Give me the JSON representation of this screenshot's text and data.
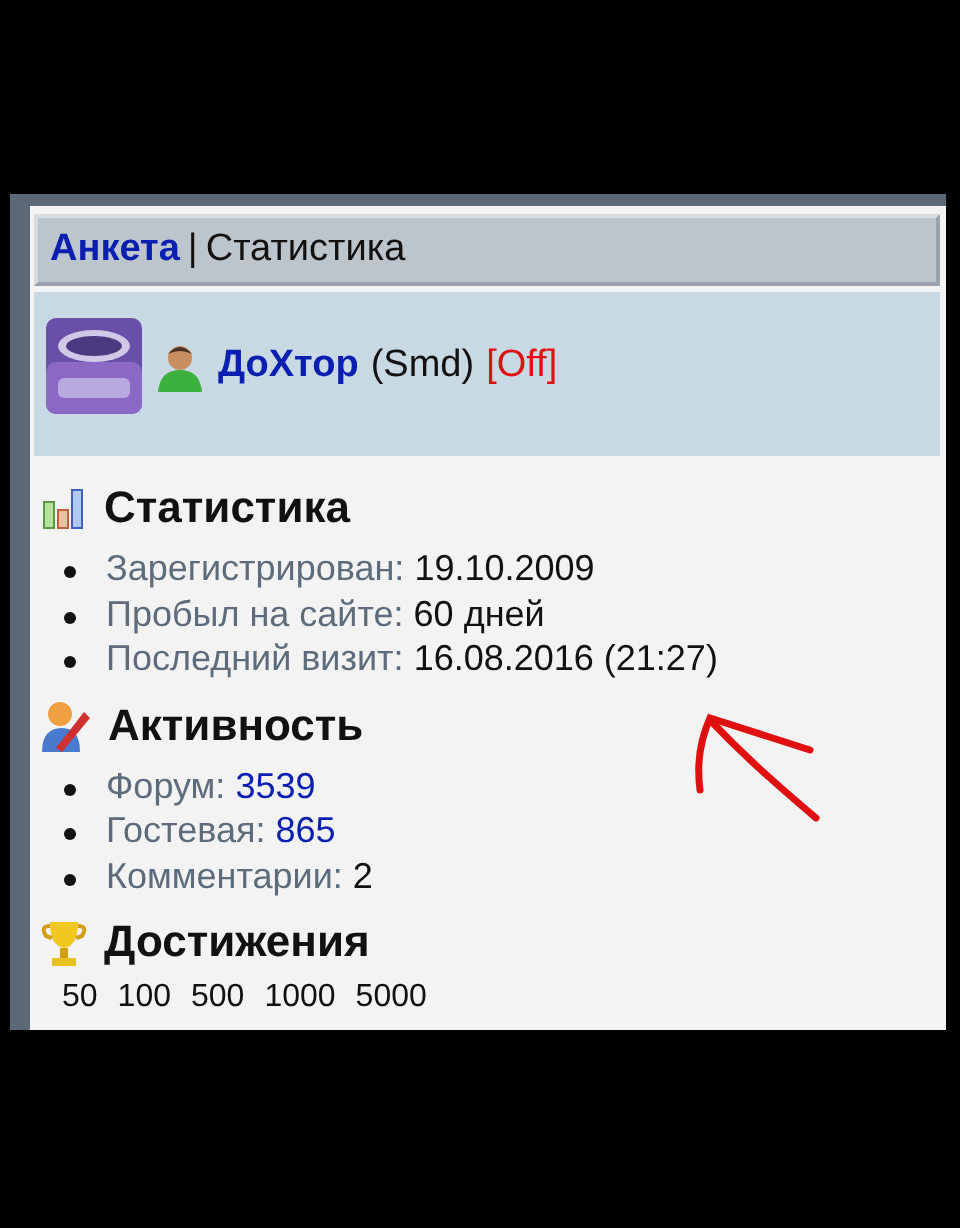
{
  "header": {
    "link": "Анкета",
    "separator": "|",
    "title": "Статистика"
  },
  "profile": {
    "name": "ДоХтор",
    "group": "(Smd)",
    "status": "[Off]"
  },
  "sections": [
    {
      "kind": "chart",
      "title": "Статистика",
      "items": [
        {
          "label": "Зарегистрирован:",
          "value": "19.10.2009",
          "kind": "text"
        },
        {
          "label": "Пробыл на сайте:",
          "value": "60 дней",
          "kind": "text"
        },
        {
          "label": "Последний визит:",
          "value": "16.08.2016 (21:27)",
          "kind": "text"
        }
      ]
    },
    {
      "kind": "writer",
      "title": "Активность",
      "items": [
        {
          "label": "Форум:",
          "value": "3539",
          "kind": "link"
        },
        {
          "label": "Гостевая:",
          "value": "865",
          "kind": "link"
        },
        {
          "label": "Комментарии:",
          "value": "2",
          "kind": "text"
        }
      ]
    },
    {
      "kind": "trophy",
      "title": "Достижения",
      "levels": [
        "50",
        "100",
        "500",
        "1000",
        "5000"
      ]
    }
  ]
}
